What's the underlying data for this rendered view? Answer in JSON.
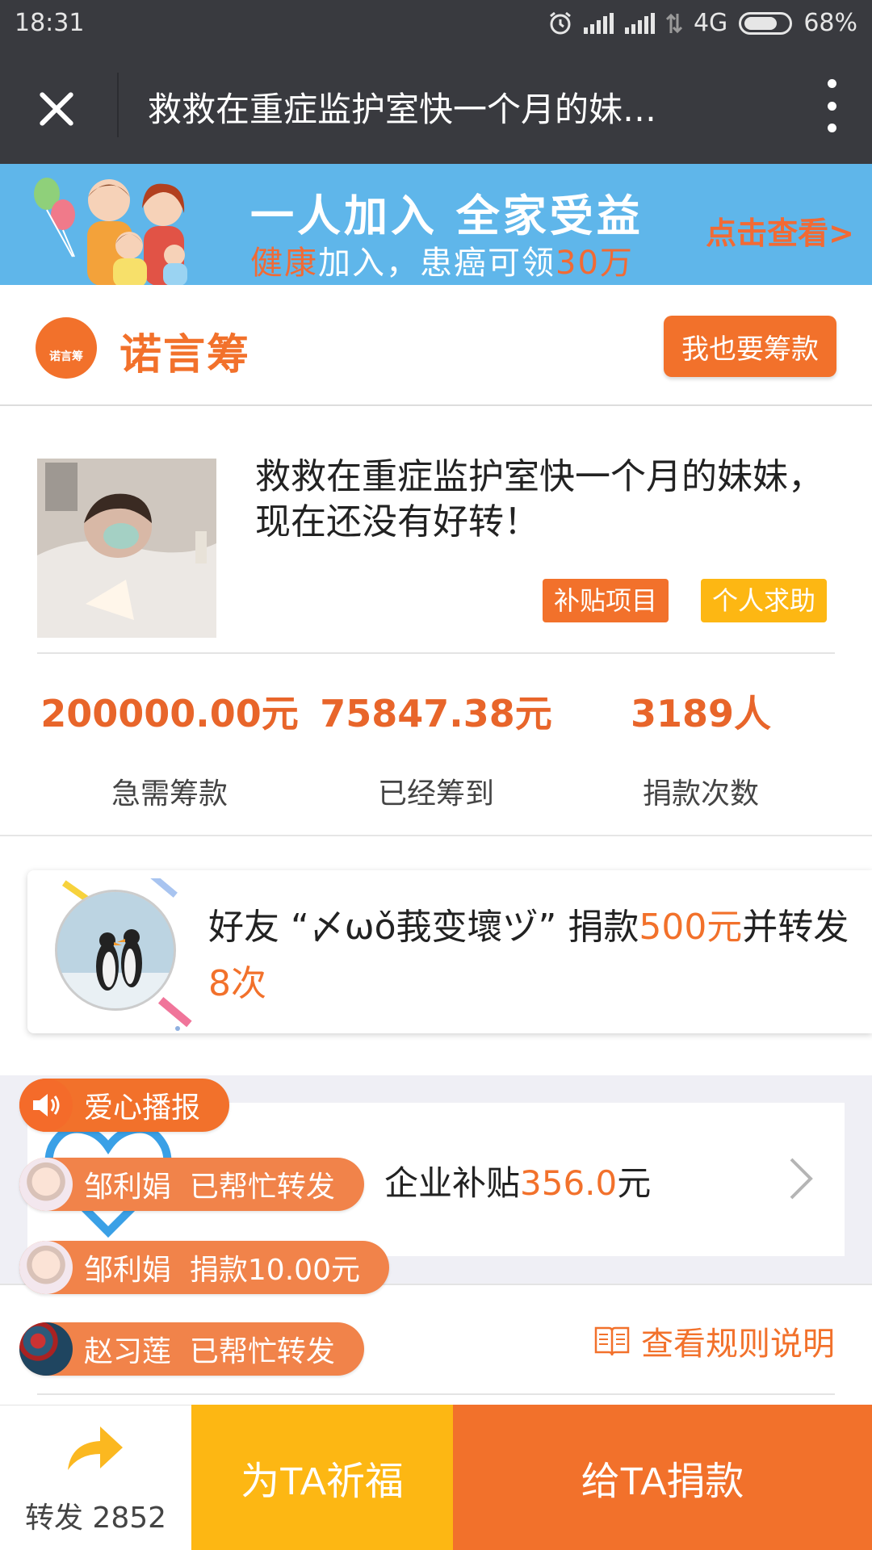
{
  "status": {
    "time": "18:31",
    "network": "4G",
    "battery": "68%",
    "icons": [
      "alarm-icon",
      "signal-icon",
      "signal-icon",
      "data-arrows-icon",
      "battery-icon"
    ]
  },
  "titlebar": {
    "title": "救救在重症监护室快一个月的妹…",
    "close_icon": "close-icon",
    "more_icon": "more-vertical-icon"
  },
  "banner": {
    "headline": "一人加入  全家受益",
    "sub_orange_1": "健康",
    "sub_white_1": "加入，患癌可领",
    "sub_orange_2": "30万",
    "cta": "点击查看>"
  },
  "brand": {
    "logo_small": "诺言筹",
    "name": "诺言筹",
    "raise_button": "我也要筹款"
  },
  "project": {
    "title": "救救在重症监护室快一个月的妹妹，现在还没有好转！",
    "tags": [
      "补贴项目",
      "个人求助"
    ],
    "stats": [
      {
        "value": "200000.00元",
        "label": "急需筹款"
      },
      {
        "value": "75847.38元",
        "label": "已经筹到"
      },
      {
        "value": "3189人",
        "label": "捐款次数"
      }
    ]
  },
  "friend": {
    "prefix": "好友 “〆ωǒ莪变壞ヅ” 捐款",
    "amount": "500元",
    "middle": "并转发",
    "times": "8次"
  },
  "subsidy": {
    "prefix": "企业补贴",
    "amount": "356.0",
    "suffix": "元"
  },
  "broadcast": {
    "header": "爱心播报",
    "items": [
      {
        "name": "邹利娟",
        "action": "已帮忙转发"
      },
      {
        "name": "邹利娟",
        "action": "捐款10.00元"
      },
      {
        "name": "赵习莲",
        "action": "已帮忙转发"
      }
    ]
  },
  "rules": {
    "label": "查看规则说明"
  },
  "bottom": {
    "share_label": "转发 2852",
    "pray_button": "为TA祈福",
    "donate_button": "给TA捐款"
  },
  "colors": {
    "orange": "#f2712b",
    "yellow": "#fdb713",
    "titlebar": "#393a3f",
    "banner": "#5fb6ea"
  }
}
